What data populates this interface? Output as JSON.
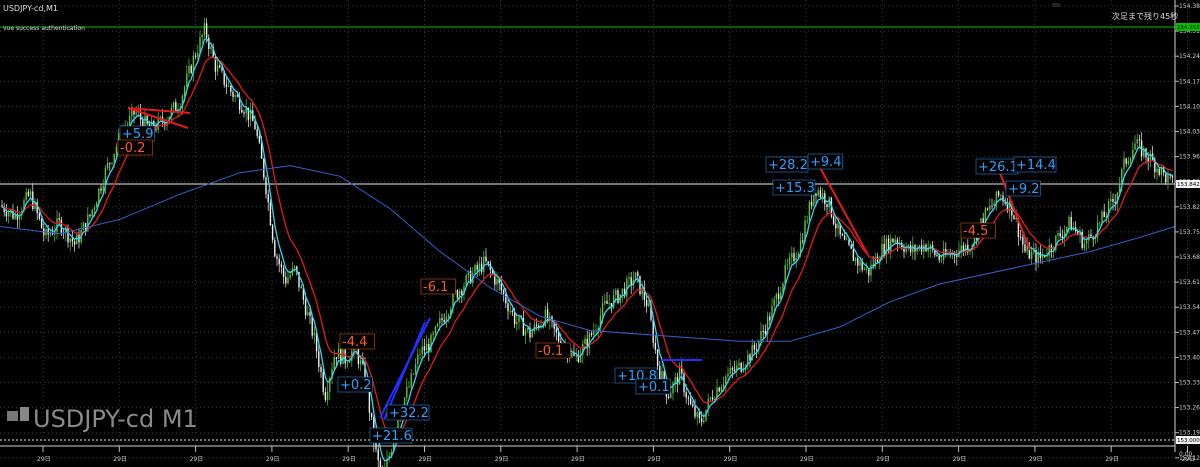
{
  "window": {
    "symbol_title": "USDJPY-cd,M1",
    "auth_message": "vue success authentication",
    "countdown_text": "次足まで残り45秒",
    "watermark_text": "USDJPY-cd M1"
  },
  "colors": {
    "background": "#000000",
    "grid": "#3a3a3a",
    "ask_line": "#00c000",
    "bid_line": "#e8e8e8",
    "candle_up": "#5ec43c",
    "candle_down": "#f0f0f0",
    "ma_fast": "#35d6e8",
    "ma_slow": "#e21b1b",
    "ma_long": "#3a5fd0",
    "label_blue_text": "#2fa0ff",
    "label_red_text": "#ff5a2a",
    "price_axis_text": "#cfcfcf"
  },
  "price_axis": {
    "ticks": [
      "154.385",
      "154.315",
      "154.245",
      "154.175",
      "154.105",
      "154.035",
      "153.965",
      "153.895",
      "153.825",
      "153.755",
      "153.685",
      "153.615",
      "153.545",
      "153.475",
      "153.405",
      "153.335",
      "153.265",
      "153.195",
      "153.125",
      "153.055"
    ],
    "current_price": "153.842",
    "ask_price": "154.352",
    "bottom_price": "153.000",
    "bottom_subvalue": "0.00"
  },
  "time_axis": {
    "ticks": [
      "29日",
      "29日",
      "29日",
      "29日",
      "29日",
      "29日",
      "29日",
      "29日",
      "29日",
      "29日",
      "29日",
      "29日",
      "29日",
      "29日",
      "29日",
      "29日"
    ]
  },
  "annotations": [
    {
      "text": "+5.9",
      "color": "blue"
    },
    {
      "text": "-0.2",
      "color": "red"
    },
    {
      "text": "-6.1",
      "color": "red"
    },
    {
      "text": "-4.4",
      "color": "red"
    },
    {
      "text": "+0.2",
      "color": "blue"
    },
    {
      "text": "+32.2",
      "color": "blue"
    },
    {
      "text": "+21.6",
      "color": "blue"
    },
    {
      "text": "-0.1",
      "color": "red"
    },
    {
      "text": "+10.8",
      "color": "blue"
    },
    {
      "text": "+0.1",
      "color": "blue"
    },
    {
      "text": "+28.2",
      "color": "blue"
    },
    {
      "text": "+9.4",
      "color": "blue"
    },
    {
      "text": "+15.3",
      "color": "blue"
    },
    {
      "text": "+26.1",
      "color": "blue"
    },
    {
      "text": "+14.4",
      "color": "blue"
    },
    {
      "text": "+9.2",
      "color": "blue"
    },
    {
      "text": "-4.5",
      "color": "red"
    }
  ],
  "price_path": [
    [
      0,
      153.83
    ],
    [
      15,
      153.8
    ],
    [
      30,
      153.86
    ],
    [
      45,
      153.74
    ],
    [
      60,
      153.78
    ],
    [
      75,
      153.72
    ],
    [
      90,
      153.8
    ],
    [
      105,
      153.92
    ],
    [
      120,
      154.02
    ],
    [
      135,
      154.09
    ],
    [
      150,
      154.04
    ],
    [
      165,
      154.07
    ],
    [
      180,
      154.12
    ],
    [
      195,
      154.25
    ],
    [
      205,
      154.32
    ],
    [
      215,
      154.22
    ],
    [
      230,
      154.15
    ],
    [
      245,
      154.1
    ],
    [
      255,
      154.05
    ],
    [
      265,
      153.9
    ],
    [
      275,
      153.7
    ],
    [
      285,
      153.62
    ],
    [
      295,
      153.65
    ],
    [
      305,
      153.55
    ],
    [
      315,
      153.45
    ],
    [
      325,
      153.3
    ],
    [
      335,
      153.42
    ],
    [
      345,
      153.4
    ],
    [
      355,
      153.43
    ],
    [
      365,
      153.35
    ],
    [
      375,
      153.15
    ],
    [
      382,
      153.06
    ],
    [
      390,
      153.14
    ],
    [
      400,
      153.26
    ],
    [
      410,
      153.33
    ],
    [
      420,
      153.42
    ],
    [
      430,
      153.44
    ],
    [
      440,
      153.5
    ],
    [
      455,
      153.58
    ],
    [
      470,
      153.63
    ],
    [
      485,
      153.67
    ],
    [
      500,
      153.6
    ],
    [
      515,
      153.51
    ],
    [
      530,
      153.47
    ],
    [
      545,
      153.52
    ],
    [
      560,
      153.45
    ],
    [
      575,
      153.4
    ],
    [
      590,
      153.46
    ],
    [
      605,
      153.55
    ],
    [
      620,
      153.58
    ],
    [
      635,
      153.63
    ],
    [
      648,
      153.55
    ],
    [
      658,
      153.38
    ],
    [
      668,
      153.3
    ],
    [
      680,
      153.36
    ],
    [
      690,
      153.27
    ],
    [
      700,
      153.22
    ],
    [
      712,
      153.3
    ],
    [
      725,
      153.35
    ],
    [
      740,
      153.38
    ],
    [
      755,
      153.43
    ],
    [
      770,
      153.52
    ],
    [
      785,
      153.64
    ],
    [
      800,
      153.72
    ],
    [
      815,
      153.88
    ],
    [
      828,
      153.84
    ],
    [
      840,
      153.74
    ],
    [
      855,
      153.68
    ],
    [
      868,
      153.64
    ],
    [
      880,
      153.7
    ],
    [
      895,
      153.74
    ],
    [
      910,
      153.7
    ],
    [
      925,
      153.72
    ],
    [
      940,
      153.68
    ],
    [
      955,
      153.7
    ],
    [
      970,
      153.72
    ],
    [
      985,
      153.8
    ],
    [
      1000,
      153.86
    ],
    [
      1012,
      153.82
    ],
    [
      1025,
      153.7
    ],
    [
      1040,
      153.68
    ],
    [
      1055,
      153.73
    ],
    [
      1070,
      153.78
    ],
    [
      1085,
      153.72
    ],
    [
      1100,
      153.78
    ],
    [
      1115,
      153.85
    ],
    [
      1125,
      153.95
    ],
    [
      1135,
      154.0
    ],
    [
      1150,
      153.96
    ],
    [
      1165,
      153.91
    ],
    [
      1175,
      153.88
    ]
  ],
  "ma_long_path": [
    [
      0,
      153.77
    ],
    [
      60,
      153.75
    ],
    [
      120,
      153.79
    ],
    [
      180,
      153.86
    ],
    [
      240,
      153.92
    ],
    [
      290,
      153.94
    ],
    [
      340,
      153.91
    ],
    [
      390,
      153.82
    ],
    [
      440,
      153.7
    ],
    [
      490,
      153.6
    ],
    [
      540,
      153.52
    ],
    [
      590,
      153.48
    ],
    [
      640,
      153.47
    ],
    [
      690,
      153.46
    ],
    [
      740,
      153.45
    ],
    [
      790,
      153.45
    ],
    [
      840,
      153.49
    ],
    [
      890,
      153.56
    ],
    [
      940,
      153.61
    ],
    [
      990,
      153.64
    ],
    [
      1040,
      153.67
    ],
    [
      1090,
      153.7
    ],
    [
      1140,
      153.74
    ],
    [
      1175,
      153.77
    ]
  ]
}
